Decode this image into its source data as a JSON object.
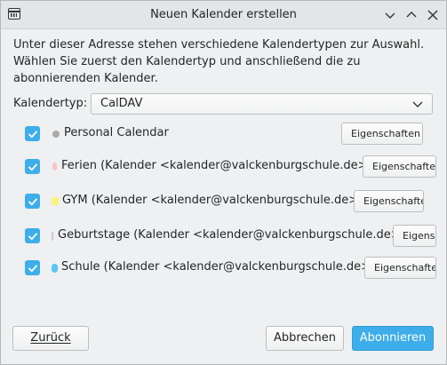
{
  "window": {
    "title": "Neuen Kalender erstellen"
  },
  "description": "Unter dieser Adresse stehen verschiedene Kalendertypen zur Auswahl. Wählen Sie zuerst den Kalendertyp und anschließend die zu abonnierenden Kalender.",
  "calendar_type": {
    "label": "Kalendertyp:",
    "selected": "CalDAV"
  },
  "calendars": [
    {
      "label": "Personal Calendar",
      "color": "#aaaaaa",
      "checked": true,
      "button": "Eigenschaften"
    },
    {
      "label": "Ferien (Kalender <kalender@valckenburgschule.de>)",
      "color": "#f6c6c6",
      "checked": true,
      "button": "Eigenschaften"
    },
    {
      "label": "GYM (Kalender <kalender@valckenburgschule.de>)",
      "color": "#f8f57a",
      "checked": true,
      "button": "Eigenschaften"
    },
    {
      "label": "Geburtstage (Kalender <kalender@valckenburgschule.de>)",
      "color": "#cccccc",
      "checked": true,
      "button": "Eigenschaften"
    },
    {
      "label": "Schule (Kalender <kalender@valckenburgschule.de>)",
      "color": "#56c7f7",
      "checked": true,
      "button": "Eigenschaften"
    }
  ],
  "buttons": {
    "back": "Zurück",
    "cancel": "Abbrechen",
    "subscribe": "Abonnieren"
  },
  "colors": {
    "accent": "#3daee9"
  }
}
